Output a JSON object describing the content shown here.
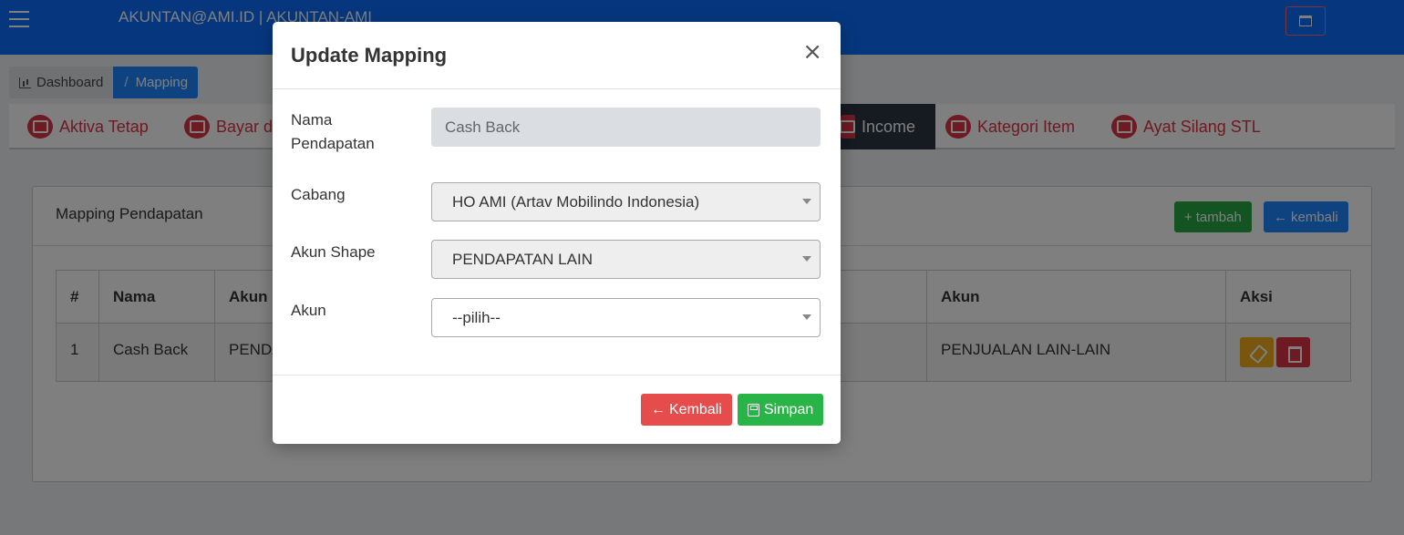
{
  "header": {
    "user_title": "AKUNTAN@AMI.ID | AKUNTAN-AMI"
  },
  "breadcrumb": {
    "dashboard": "Dashboard",
    "separator": "/",
    "mapping": "Mapping"
  },
  "tabs": [
    {
      "label": "Aktiva Tetap",
      "icon": "chart-icon"
    },
    {
      "label": "Bayar di",
      "icon": "wallet-icon"
    },
    {
      "label": "Income",
      "icon": "card-icon",
      "active": true
    },
    {
      "label": "Kategori Item",
      "icon": "check-square-icon"
    },
    {
      "label": "Ayat Silang STL",
      "icon": "wallet-icon"
    }
  ],
  "card": {
    "title": "Mapping Pendapatan",
    "add_button": "tambah",
    "add_icon": "+",
    "back_button": "kembali",
    "back_icon": "←"
  },
  "table": {
    "headers": [
      "#",
      "Nama",
      "Akun",
      "Akun",
      "Aksi"
    ],
    "rows": [
      {
        "no": "1",
        "nama": "Cash Back",
        "akun_shape": "PENDA",
        "akun": "PENJUALAN LAIN-LAIN"
      }
    ]
  },
  "modal": {
    "title": "Update Mapping",
    "close_symbol": "×",
    "fields": {
      "nama_pendapatan": {
        "label_line1": "Nama",
        "label_line2": "Pendapatan",
        "value": "Cash Back"
      },
      "cabang": {
        "label": "Cabang",
        "value": "HO AMI (Artav Mobilindo Indonesia)"
      },
      "akun_shape": {
        "label": "Akun Shape",
        "value": "PENDAPATAN LAIN"
      },
      "akun": {
        "label": "Akun",
        "value": "--pilih--"
      }
    },
    "buttons": {
      "kembali": "Kembali",
      "kembali_icon": "←",
      "simpan": "Simpan"
    }
  },
  "colors": {
    "header_bg": "#0d6efd",
    "danger": "#dc3545",
    "success": "#28a745",
    "primary": "#1f87ff",
    "warning": "#f0ad1a"
  }
}
